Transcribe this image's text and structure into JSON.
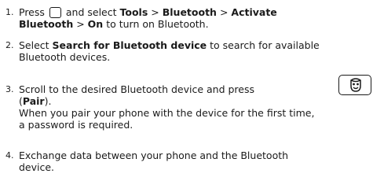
{
  "steps": [
    {
      "number": "1.",
      "line1_pre": "Press",
      "line1_mid": "and select",
      "tools": "Tools",
      "sep1": ">",
      "bluetooth": "Bluetooth",
      "sep2": ">",
      "activate": "Activate",
      "activate_bt": "Bluetooth",
      "sep3": ">",
      "on": "On",
      "line2_post": "to turn on Bluetooth."
    },
    {
      "number": "2.",
      "pre": "Select",
      "search": "Search for Bluetooth device",
      "post1": "to search for available",
      "post2": "Bluetooth devices."
    },
    {
      "number": "3.",
      "pre": "Scroll to the desired Bluetooth device and press",
      "paren_open": "(",
      "pair": "Pair",
      "paren_close": ").",
      "note1": "When you pair your phone with the device for the first time,",
      "note2": "a password is required."
    },
    {
      "number": "4.",
      "line1": "Exchange data between your phone and the Bluetooth",
      "line2": "device."
    }
  ],
  "icons": [
    "menu-key-icon",
    "smiley-key-icon"
  ]
}
